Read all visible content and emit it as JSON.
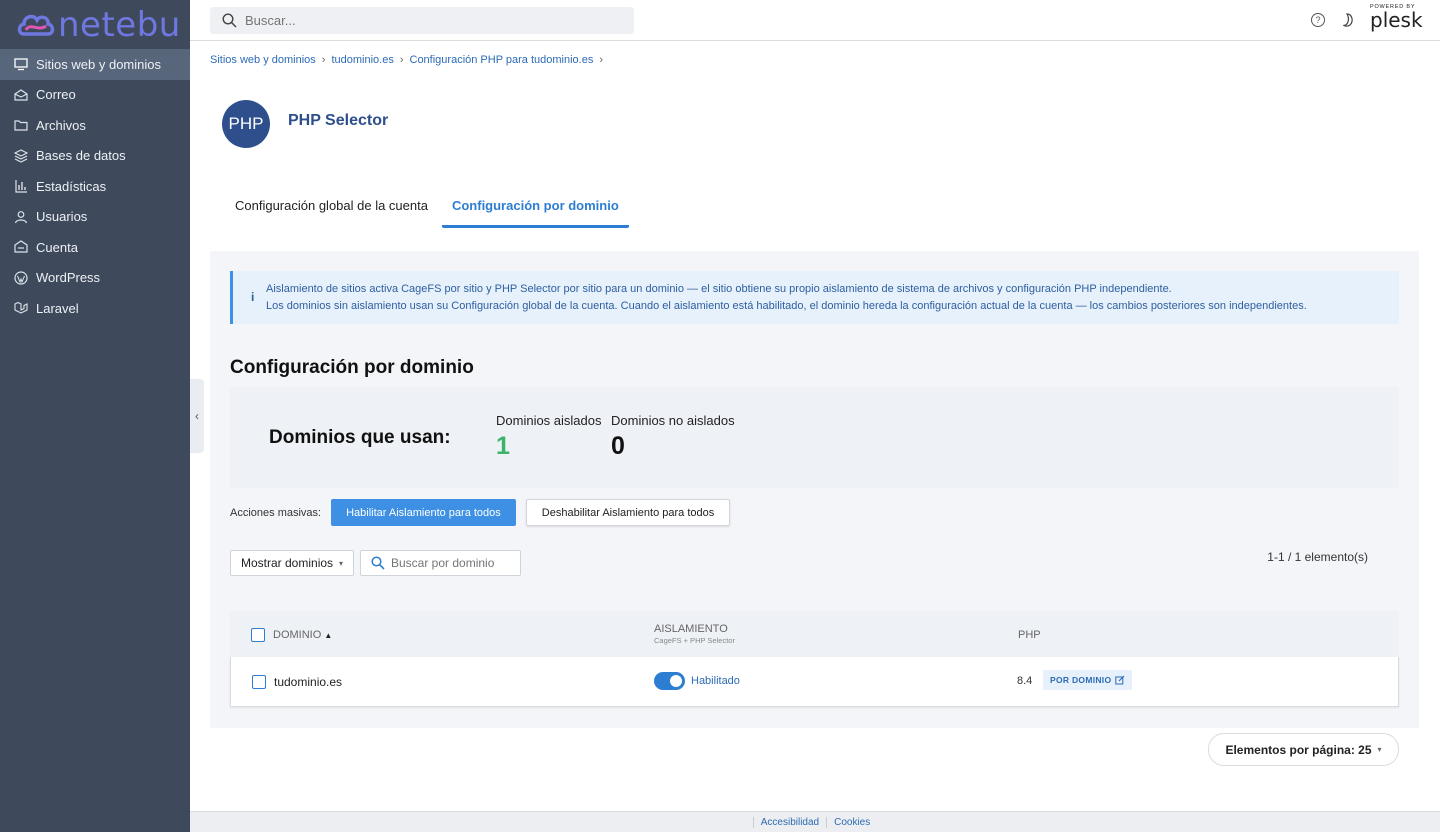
{
  "brand": {
    "name": "netebu",
    "color": "#6f78e0"
  },
  "topbar": {
    "search_placeholder": "Buscar...",
    "powered_by": "POWERED BY",
    "plesk": "plesk"
  },
  "sidebar": {
    "items": [
      {
        "label": "Sitios web y dominios",
        "icon": "monitor-icon",
        "active": true
      },
      {
        "label": "Correo",
        "icon": "mail-icon"
      },
      {
        "label": "Archivos",
        "icon": "folder-icon"
      },
      {
        "label": "Bases de datos",
        "icon": "database-icon"
      },
      {
        "label": "Estadísticas",
        "icon": "chart-icon"
      },
      {
        "label": "Usuarios",
        "icon": "user-icon"
      },
      {
        "label": "Cuenta",
        "icon": "account-icon"
      },
      {
        "label": "WordPress",
        "icon": "wordpress-icon"
      },
      {
        "label": "Laravel",
        "icon": "laravel-icon"
      }
    ]
  },
  "breadcrumb": [
    "Sitios web y dominios",
    "tudominio.es",
    "Configuración PHP para tudominio.es"
  ],
  "page": {
    "title": "PHP Selector",
    "logo_text": "PHP"
  },
  "tabs": [
    {
      "label": "Configuración global de la cuenta",
      "active": false
    },
    {
      "label": "Configuración por dominio",
      "active": true
    }
  ],
  "info": {
    "line1": "Aislamiento de sitios activa CageFS por sitio y PHP Selector por sitio para un dominio — el sitio obtiene su propio aislamiento de sistema de archivos y configuración PHP independiente.",
    "line2": "Los dominios sin aislamiento usan su Configuración global de la cuenta. Cuando el aislamiento está habilitado, el dominio hereda la configuración actual de la cuenta — los cambios posteriores son independientes."
  },
  "section": {
    "title": "Configuración por dominio",
    "summary_label": "Dominios que usan:",
    "stats": [
      {
        "label": "Dominios aislados",
        "value": "1",
        "color": "#3bb36b"
      },
      {
        "label": "Dominios no aislados",
        "value": "0",
        "color": "#111111"
      }
    ]
  },
  "bulk": {
    "label": "Acciones masivas:",
    "enable_all": "Habilitar Aislamiento para todos",
    "disable_all": "Deshabilitar Aislamiento para todos"
  },
  "filter": {
    "show_domains": "Mostrar dominios",
    "search_placeholder": "Buscar por dominio",
    "count": "1-1 / 1 elemento(s)"
  },
  "table": {
    "columns": {
      "domain": "DOMINIO",
      "isolation": "AISLAMIENTO",
      "isolation_sub": "CageFS + PHP Selector",
      "php": "PHP"
    },
    "rows": [
      {
        "domain": "tudominio.es",
        "isolation_enabled": true,
        "status": "Habilitado",
        "php": "8.4",
        "badge": "POR DOMINIO"
      }
    ]
  },
  "pagination": {
    "per_page": "Elementos por página: 25"
  },
  "footer": {
    "links": [
      "Accesibilidad",
      "Cookies"
    ]
  }
}
